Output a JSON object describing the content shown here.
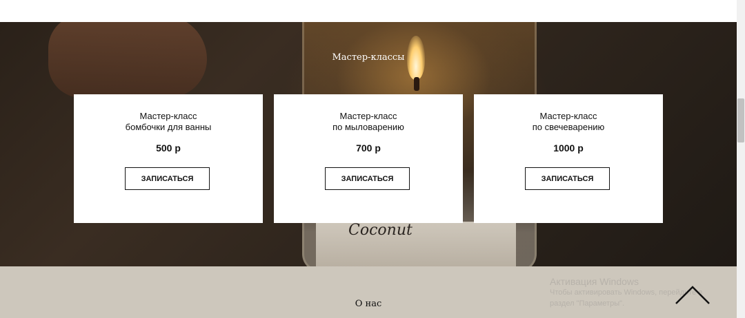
{
  "section": {
    "title": "Мастер-классы"
  },
  "hero": {
    "jar_label": "Coconut"
  },
  "cards": [
    {
      "title_line1": "Мастер-класс",
      "title_line2": "бомбочки для ванны",
      "price": "500 р",
      "button": "ЗАПИСАТЬСЯ"
    },
    {
      "title_line1": "Мастер-класс",
      "title_line2": "по мыловарению",
      "price": "700 р",
      "button": "ЗАПИСАТЬСЯ"
    },
    {
      "title_line1": "Мастер-класс",
      "title_line2": "по свечеварению",
      "price": "1000 р",
      "button": "ЗАПИСАТЬСЯ"
    }
  ],
  "footer": {
    "title": "О нас"
  },
  "windows_activation": {
    "title": "Активация Windows",
    "text": "Чтобы активировать Windows, перейдите в раздел \"Параметры\"."
  },
  "colors": {
    "footer_bg": "#cdc7bc",
    "card_bg": "#ffffff"
  },
  "icons": {
    "scroll_top": "chevron-up-icon"
  }
}
